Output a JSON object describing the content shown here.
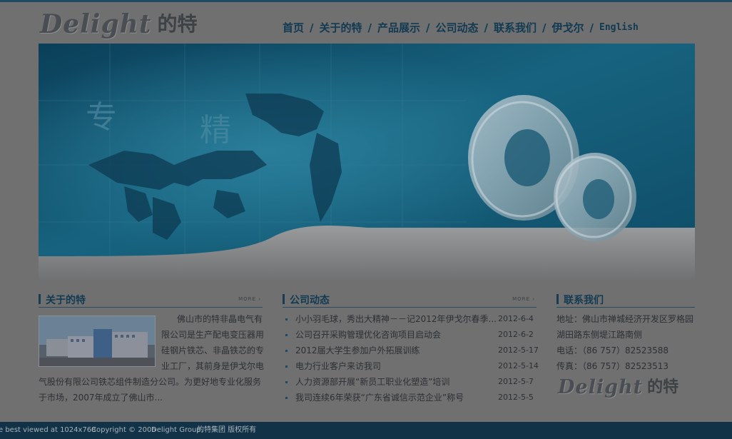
{
  "header": {
    "logo_latin": "Delight",
    "logo_cn": "的特",
    "nav": [
      {
        "label": "首页"
      },
      {
        "label": "关于的特"
      },
      {
        "label": "产品展示"
      },
      {
        "label": "公司动态"
      },
      {
        "label": "联系我们"
      },
      {
        "label": "伊戈尔"
      },
      {
        "label": "English"
      }
    ],
    "nav_separator": "/"
  },
  "banner": {
    "overlay_char1": "专",
    "overlay_char2": "精",
    "colors": {
      "sky_top": "#0e4a66",
      "sky_mid": "#1e6d8a",
      "curve": "#8d8e90"
    }
  },
  "about": {
    "title": "关于的特",
    "more": "MORE",
    "text": "佛山市的特非晶电气有限公司是生产配电变压器用硅钢片铁芯、非晶铁芯的专业工厂，其前身是伊戈尔电气股份有限公司铁芯组件制造分公司。为更好地专业化服务于市场，2007年成立了佛山市..."
  },
  "news": {
    "title": "公司动态",
    "more": "MORE",
    "items": [
      {
        "title": "小小羽毛球，秀出大精神－－记2012年伊戈尔春季...",
        "date": "2012-6-4"
      },
      {
        "title": "公司召开采购管理优化咨询项目启动会",
        "date": "2012-6-2"
      },
      {
        "title": "2012届大学生参加户外拓展训练",
        "date": "2012-5-17"
      },
      {
        "title": "电力行业客户来访我司",
        "date": "2012-5-14"
      },
      {
        "title": "人力资源部开展“新员工职业化塑造”培训",
        "date": "2012-5-7"
      },
      {
        "title": "我司连续6年荣获“广东省诚信示范企业”称号",
        "date": "2012-5-5"
      }
    ]
  },
  "contact": {
    "title": "联系我们",
    "address_line1": "地址：佛山市禅城经济开发区罗格园",
    "address_line2": "湖田路东侧堤江路南侧",
    "phone": "电话：（86 757）82523588",
    "fax": "传真：（86 757）82523513",
    "logo_latin": "Delight",
    "logo_cn": "的特"
  },
  "footer": {
    "best_viewed": "e best viewed at 1024x768",
    "copyright": "Copyright © 2006",
    "company": "Delight Group.",
    "rights": "的特集团 版权所有"
  }
}
